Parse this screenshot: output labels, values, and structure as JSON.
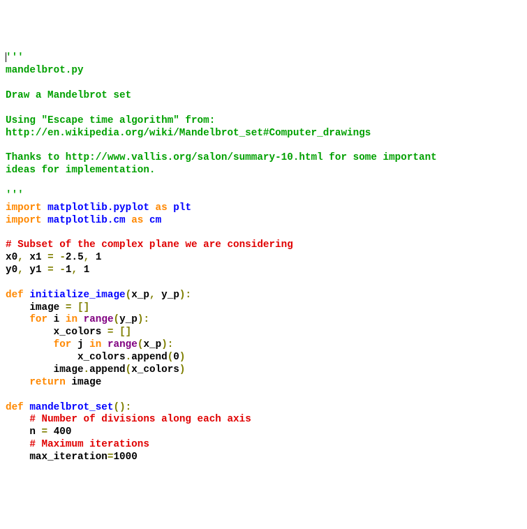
{
  "code": {
    "docstring_open": "'''",
    "doc_line1": "mandelbrot.py",
    "doc_line2": "Draw a Mandelbrot set",
    "doc_line3": "Using \"Escape time algorithm\" from:",
    "doc_line4": "http://en.wikipedia.org/wiki/Mandelbrot_set#Computer_drawings",
    "doc_line5": "Thanks to http://www.vallis.org/salon/summary-10.html for some important",
    "doc_line6": "ideas for implementation.",
    "docstring_close": "'''",
    "kw_import": "import",
    "kw_as": "as",
    "kw_def": "def",
    "kw_for": "for",
    "kw_in": "in",
    "kw_return": "return",
    "mod_plt": "matplotlib.pyplot",
    "alias_plt": "plt",
    "mod_cm": "matplotlib.cm",
    "alias_cm": "cm",
    "cmt_subset": "# Subset of the complex plane we are considering",
    "assign_x": "x0, x1 = -2.5, 1",
    "assign_x_lhs1": "x0",
    "assign_x_lhs2": "x1",
    "assign_x_v1": "-2.5",
    "assign_x_v2": "1",
    "assign_y_lhs1": "y0",
    "assign_y_lhs2": "y1",
    "assign_y_v1": "-1",
    "assign_y_v2": "1",
    "fn_init": "initialize_image",
    "param_xp": "x_p",
    "param_yp": "y_p",
    "var_image": "image",
    "var_i": "i",
    "var_j": "j",
    "builtin_range": "range",
    "var_xcolors": "x_colors",
    "lit_zero": "0",
    "meth_append": "append",
    "fn_mandel": "mandelbrot_set",
    "cmt_divisions": "# Number of divisions along each axis",
    "var_n": "n",
    "val_400": "400",
    "cmt_maxiter": "# Maximum iterations",
    "var_maxiter": "max_iteration",
    "val_1000": "1000",
    "sym_eq": "=",
    "sym_comma": ",",
    "sym_colon": ":",
    "sym_dot": ".",
    "sym_lparen": "(",
    "sym_rparen": ")",
    "sym_lbrack": "[",
    "sym_rbrack": "]",
    "sym_minus": "-",
    "sp": " "
  }
}
